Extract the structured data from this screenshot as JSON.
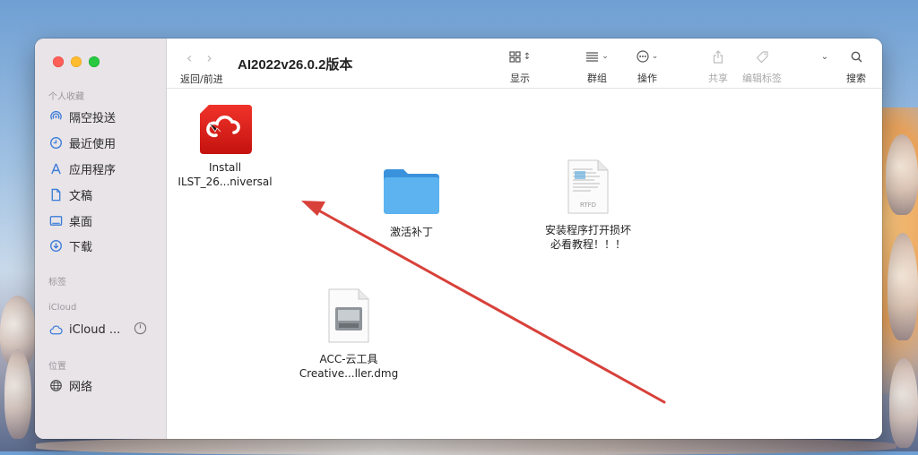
{
  "window": {
    "title": "AI2022v26.0.2版本"
  },
  "nav": {
    "label": "返回/前进"
  },
  "toolbar": {
    "view_label": "显示",
    "group_label": "群组",
    "action_label": "操作",
    "share_label": "共享",
    "tags_label": "编辑标签",
    "search_label": "搜索"
  },
  "sidebar": {
    "favorites_title": "个人收藏",
    "favorites": [
      {
        "label": "隔空投送",
        "icon": "airdrop-icon"
      },
      {
        "label": "最近使用",
        "icon": "clock-icon"
      },
      {
        "label": "应用程序",
        "icon": "applications-icon"
      },
      {
        "label": "文稿",
        "icon": "document-icon"
      },
      {
        "label": "桌面",
        "icon": "desktop-icon"
      },
      {
        "label": "下载",
        "icon": "download-icon"
      }
    ],
    "tags_title": "标签",
    "icloud_title": "iCloud",
    "icloud_item": "iCloud ...",
    "locations_title": "位置",
    "locations": [
      {
        "label": "网络",
        "icon": "network-globe-icon"
      }
    ]
  },
  "files": [
    {
      "line1": "Install",
      "line2": "ILST_26...niversal",
      "icon": "adobe-creative-cloud-icon"
    },
    {
      "line1": "激活补丁",
      "line2": "",
      "icon": "folder-icon"
    },
    {
      "line1": "安装程序打开损坏",
      "line2": "必看教程！！！",
      "icon": "rtfd-document-icon"
    },
    {
      "line1": "ACC-云工具",
      "line2": "Creative...ller.dmg",
      "icon": "disk-image-icon"
    }
  ],
  "colors": {
    "accent": "#3a7cd8",
    "adobe_red": "#e01e1a",
    "folder_blue": "#4fa8ea",
    "annotation_arrow": "#d8413a"
  }
}
